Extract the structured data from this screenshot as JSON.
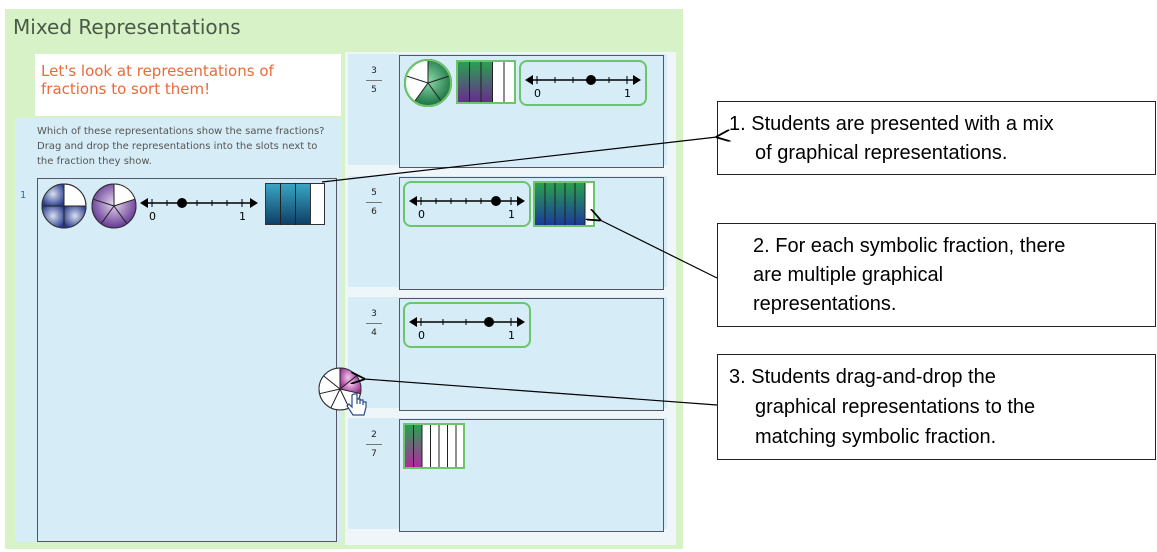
{
  "app": {
    "title": "Mixed Representations",
    "heading": "Let's look at representations of fractions to sort them!",
    "instructions": "Which of these representations show the same fractions? Drag and drop the representations into the slots next to the fraction they show.",
    "source_index": "1"
  },
  "source_items": [
    "circle-quarters-icon",
    "circle-fifths-icon",
    "number-line-icon",
    "fraction-bar-icon"
  ],
  "number_line_labels": {
    "zero": "0",
    "one": "1"
  },
  "slots": [
    {
      "numerator": "3",
      "denominator": "5"
    },
    {
      "numerator": "5",
      "denominator": "6"
    },
    {
      "numerator": "3",
      "denominator": "4"
    },
    {
      "numerator": "2",
      "denominator": "7"
    }
  ],
  "callouts": [
    {
      "line1": "1. Students are presented with a mix",
      "line2": "of graphical representations."
    },
    {
      "line1": "2. For each symbolic fraction, there",
      "line2": "are multiple graphical",
      "line3": "representations."
    },
    {
      "line1": "3. Students drag-and-drop the",
      "line2": "graphical representations to the",
      "line3": "matching symbolic fraction."
    }
  ],
  "colors": {
    "app_background": "#d8f2c8",
    "panel_blue": "#d6ecf7",
    "heading_orange": "#ea6a3a",
    "accent_green": "#6cc56a"
  }
}
